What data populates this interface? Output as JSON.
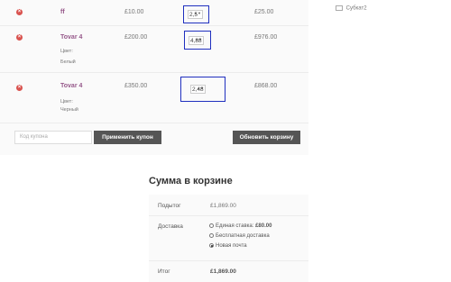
{
  "cart": {
    "items": [
      {
        "name": "ff",
        "price": "£10.00",
        "qty": "2,5",
        "subtotal": "£25.00"
      },
      {
        "name": "Tovar 4",
        "meta_label": "Цвет:",
        "meta_value": "Белый",
        "price": "£200.00",
        "qty": "4,88",
        "subtotal": "£976.00"
      },
      {
        "name": "Tovar 4",
        "meta_label": "Цвет:",
        "meta_value": "Черный",
        "price": "£350.00",
        "qty": "2,48",
        "subtotal": "£868.00"
      }
    ],
    "remove_icon": "×",
    "spinner_icon": "▲▼"
  },
  "coupon": {
    "placeholder": "Код купона",
    "apply_label": "Применить купон"
  },
  "update_label": "Обновить корзину",
  "sidebar": {
    "category": "Субкат2"
  },
  "totals": {
    "title": "Сумма в корзине",
    "subtotal_label": "Подытог",
    "subtotal_value": "£1,869.00",
    "shipping_label": "Доставка",
    "shipping_options": [
      {
        "label": "Единая ставка:",
        "price": "£80.00",
        "checked": false
      },
      {
        "label": "Бесплатная доставка",
        "checked": false
      },
      {
        "label": "Новая почта",
        "checked": true
      }
    ],
    "total_label": "Итог",
    "total_value": "£1,869.00"
  },
  "colors": {
    "accent": "#96588a",
    "button": "#555555",
    "highlight_border": "#1f2fbf",
    "remove": "#d9534f"
  }
}
